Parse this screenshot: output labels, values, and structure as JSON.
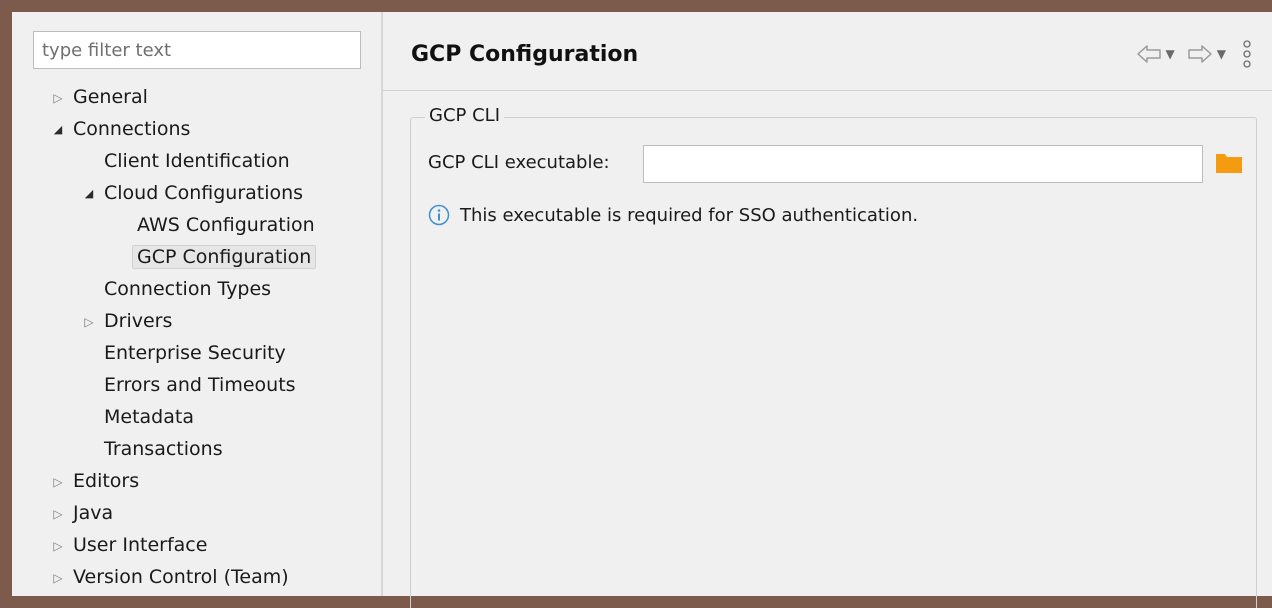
{
  "filter": {
    "placeholder": "type filter text",
    "value": ""
  },
  "tree": {
    "general": "General",
    "connections": "Connections",
    "client_identification": "Client Identification",
    "cloud_configurations": "Cloud Configurations",
    "aws_configuration": "AWS Configuration",
    "gcp_configuration": "GCP Configuration",
    "connection_types": "Connection Types",
    "drivers": "Drivers",
    "enterprise_security": "Enterprise Security",
    "errors_and_timeouts": "Errors and Timeouts",
    "metadata": "Metadata",
    "transactions": "Transactions",
    "editors": "Editors",
    "java": "Java",
    "user_interface": "User Interface",
    "version_control": "Version Control (Team)"
  },
  "page": {
    "title": "GCP Configuration",
    "group_title": "GCP CLI",
    "field_label": "GCP CLI executable:",
    "field_value": "",
    "info_text": "This executable is required for SSO authentication."
  },
  "icons": {
    "collapsed": "arrow-right-outline-icon",
    "expanded": "arrow-down-filled-icon",
    "back": "back-arrow-icon",
    "forward": "forward-arrow-icon",
    "menu": "vertical-dots-icon",
    "folder": "folder-icon",
    "info": "info-icon"
  },
  "colors": {
    "folder": "#f39c12",
    "info": "#3d8fd6",
    "window_border": "#7c5a4c"
  }
}
